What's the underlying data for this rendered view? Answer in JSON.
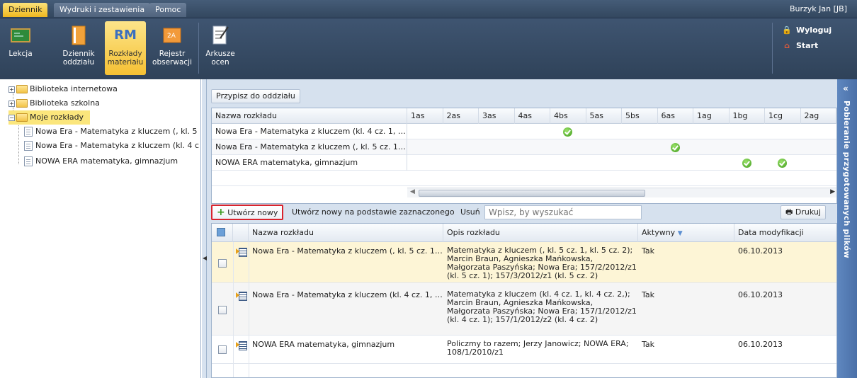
{
  "menubar": {
    "tabs": [
      "Dziennik",
      "Wydruki i zestawienia",
      "Pomoc"
    ],
    "active_tab": "Dziennik",
    "user": "Burzyk Jan [JB]"
  },
  "ribbon": {
    "buttons": [
      {
        "label1": "Lekcja",
        "label2": "",
        "icon": "lesson-board-icon"
      },
      {
        "label1": "Dziennik",
        "label2": "oddziału",
        "icon": "class-register-icon"
      },
      {
        "label1": "Rozkłady",
        "label2": "materiału",
        "icon": "rm-icon",
        "icon_text": "RM"
      },
      {
        "label1": "Rejestr",
        "label2": "obserwacji",
        "icon": "observation-register-icon",
        "icon_text": "2A"
      },
      {
        "label1": "Arkusze",
        "label2": "ocen",
        "icon": "grade-sheets-icon"
      }
    ],
    "logout": "Wyloguj",
    "start": "Start"
  },
  "tree": {
    "items": [
      {
        "label": "Biblioteka internetowa"
      },
      {
        "label": "Biblioteka szkolna"
      },
      {
        "label": "Moje rozkłady"
      },
      {
        "label": "Nowa Era - Matematyka z kluczem (, kl. 5"
      },
      {
        "label": "Nowa Era - Matematyka z kluczem (kl. 4 c"
      },
      {
        "label": "NOWA ERA matematyka, gimnazjum"
      }
    ]
  },
  "assign": {
    "button": "Przypisz do oddziału",
    "name_header": "Nazwa rozkładu",
    "classes": [
      "1as",
      "2as",
      "3as",
      "4as",
      "4bs",
      "5as",
      "5bs",
      "6as",
      "1ag",
      "1bg",
      "1cg",
      "2ag"
    ],
    "rows": [
      {
        "name": "Nowa Era - Matematyka z kluczem (kl. 4 cz. 1, k...",
        "checked": [
          "4bs"
        ]
      },
      {
        "name": "Nowa Era - Matematyka z kluczem (, kl. 5 cz. 1,...",
        "checked": [
          "6as"
        ]
      },
      {
        "name": "NOWA ERA matematyka, gimnazjum",
        "checked": [
          "1bg",
          "1cg"
        ]
      }
    ]
  },
  "toolbar": {
    "create_new": "Utwórz nowy",
    "create_from": "Utwórz nowy na podstawie zaznaczonego",
    "delete": "Usuń",
    "search_placeholder": "Wpisz, by wyszukać",
    "print": "Drukuj"
  },
  "list": {
    "headers": {
      "name": "Nazwa rozkładu",
      "description": "Opis rozkładu",
      "active": "Aktywny",
      "modified": "Data modyfikacji"
    },
    "rows": [
      {
        "name": "Nowa Era - Matematyka z kluczem (, kl. 5 cz. 1,...",
        "description": "Matematyka z kluczem (, kl. 5 cz. 1, kl. 5 cz. 2); Marcin Braun, Agnieszka Mańkowska, Małgorzata Paszyńska; Nowa Era; 157/2/2012/z1 (kl. 5 cz. 1); 157/3/2012/z1 (kl. 5 cz. 2)",
        "active": "Tak",
        "modified": "06.10.2013",
        "selected": true
      },
      {
        "name": "Nowa Era - Matematyka z kluczem (kl. 4 cz. 1, k...",
        "description": "Matematyka z kluczem (kl. 4 cz. 1, kl. 4 cz. 2,); Marcin Braun, Agnieszka Mańkowska, Małgorzata Paszyńska; Nowa Era; 157/1/2012/z1 (kl. 4 cz. 1); 157/1/2012/z2 (kl. 4 cz. 2)",
        "active": "Tak",
        "modified": "06.10.2013",
        "selected": false
      },
      {
        "name": "NOWA ERA matematyka, gimnazjum",
        "description": "Policzmy to razem; Jerzy Janowicz; NOWA ERA; 108/1/2010/z1",
        "active": "Tak",
        "modified": "06.10.2013",
        "selected": false
      }
    ]
  },
  "rightbar": {
    "label": "Pobieranie przygotowanych plików"
  },
  "colors": {
    "header": "#3a4f6a",
    "active": "#f5c033",
    "selected_row": "#fdf5d6",
    "highlight_box": "#d9232d"
  }
}
